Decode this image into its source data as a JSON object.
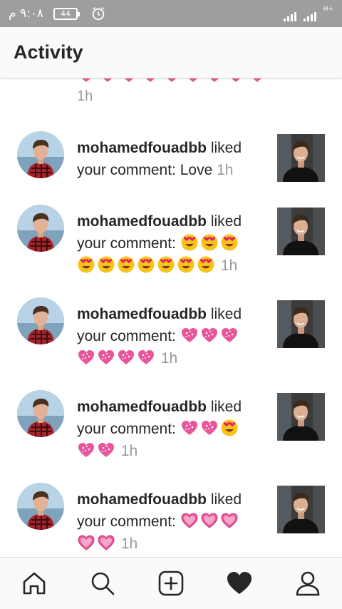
{
  "status_bar": {
    "time": "٩:٠٨ م",
    "battery": "44",
    "network": "H+"
  },
  "header": {
    "title": "Activity"
  },
  "partial_item": {
    "time": "1h",
    "emojis": [
      "heart",
      "heart",
      "heart",
      "heart",
      "heart",
      "heart",
      "heart",
      "heart",
      "heart"
    ]
  },
  "notifications": [
    {
      "username": "mohamedfouadbb",
      "action": "liked",
      "text": "your comment: Love",
      "emojis_line1": [],
      "emojis_line2": [],
      "time": "1h"
    },
    {
      "username": "mohamedfouadbb",
      "action": "liked",
      "text": "your comment:",
      "emojis_line1": [
        "heart-eyes",
        "heart-eyes",
        "heart-eyes"
      ],
      "emojis_line2": [
        "heart-eyes",
        "heart-eyes",
        "heart-eyes",
        "heart-eyes",
        "heart-eyes",
        "heart-eyes",
        "heart-eyes"
      ],
      "time": "1h"
    },
    {
      "username": "mohamedfouadbb",
      "action": "liked",
      "text": "your comment:",
      "emojis_line1": [
        "sparkle-heart",
        "sparkle-heart",
        "sparkle-heart"
      ],
      "emojis_line2": [
        "sparkle-heart",
        "sparkle-heart",
        "sparkle-heart",
        "sparkle-heart"
      ],
      "time": "1h"
    },
    {
      "username": "mohamedfouadbb",
      "action": "liked",
      "text": "your comment:",
      "emojis_line1": [
        "sparkle-heart",
        "sparkle-heart",
        "heart-eyes"
      ],
      "emojis_line2": [
        "sparkle-heart",
        "sparkle-heart"
      ],
      "time": "1h"
    },
    {
      "username": "mohamedfouadbb",
      "action": "liked",
      "text": "your comment:",
      "emojis_line1": [
        "pink-heart",
        "pink-heart",
        "pink-heart"
      ],
      "emojis_line2": [
        "pink-heart",
        "pink-heart"
      ],
      "time": "1h"
    }
  ],
  "bottom_nav": {
    "items": [
      {
        "name": "home-icon"
      },
      {
        "name": "search-icon"
      },
      {
        "name": "new-post-icon"
      },
      {
        "name": "activity-heart-icon"
      },
      {
        "name": "profile-icon"
      }
    ]
  },
  "colors": {
    "status_bar_bg": "#9e9e9e",
    "text": "#262626",
    "secondary_text": "#999999",
    "divider": "#dbdbdb",
    "emoji_pink": "#e8559a",
    "emoji_yellow": "#f7c21c"
  }
}
